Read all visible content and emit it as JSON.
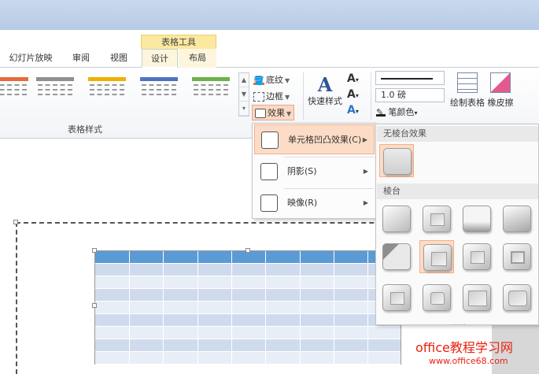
{
  "contextual_tab_header": "表格工具",
  "tabs": [
    {
      "label": "幻灯片放映"
    },
    {
      "label": "审阅"
    },
    {
      "label": "视图"
    },
    {
      "label": "设计"
    },
    {
      "label": "布局"
    }
  ],
  "ribbon": {
    "group_label": "表格样式",
    "shading": {
      "label": "底纹"
    },
    "borders": {
      "label": "边框"
    },
    "effects": {
      "label": "效果"
    },
    "quick_styles": {
      "label": "快速样式"
    },
    "line_weight": "1.0 磅",
    "pen_color": "笔颜色",
    "draw_table": "绘制表格",
    "eraser": "橡皮擦",
    "style_colors": [
      "#e46c3d",
      "#8f8f8f",
      "#f0b000",
      "#4f73c3",
      "#6cb24a"
    ]
  },
  "effects_menu": {
    "items": [
      {
        "label": "单元格凹凸效果(C)",
        "highlighted": true
      },
      {
        "label": "阴影(S)",
        "highlighted": false
      },
      {
        "label": "映像(R)",
        "highlighted": false
      }
    ]
  },
  "bevel_submenu": {
    "no_bevel_header": "无棱台效果",
    "bevel_header": "棱台",
    "bevel_count": 12
  },
  "table": {
    "header_color": "#5b9bd5",
    "band_colors": [
      "#cfdbed",
      "#e8eef7"
    ],
    "rows": 8,
    "cols": 9
  },
  "watermark": {
    "line1": "office教程学习网",
    "line2": "www.office68.com"
  }
}
